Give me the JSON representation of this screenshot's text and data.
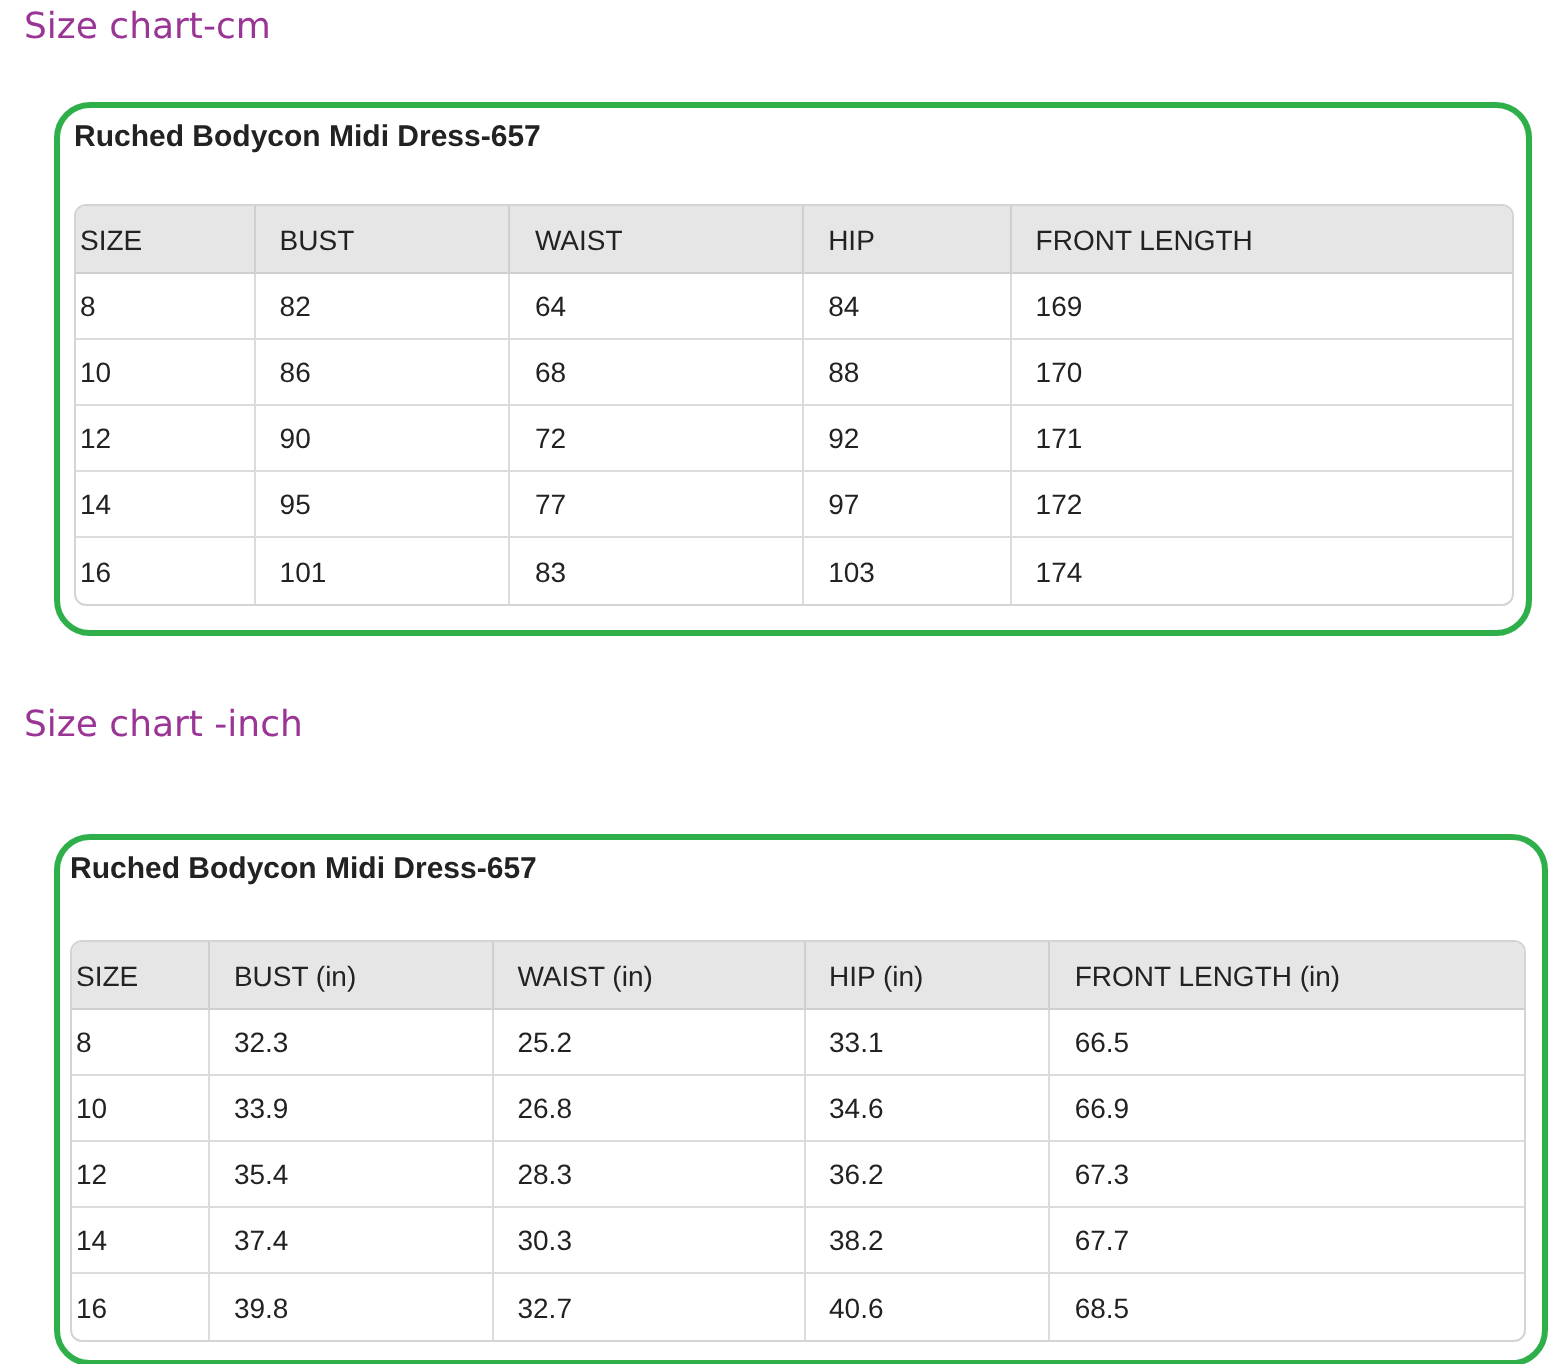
{
  "sections": [
    {
      "heading": "Size chart-cm",
      "table": {
        "title": "Ruched Bodycon Midi Dress-657",
        "columns": [
          "SIZE",
          "BUST",
          "WAIST",
          "HIP",
          "FRONT LENGTH"
        ],
        "rows": [
          [
            "8",
            "82",
            "64",
            "84",
            "169"
          ],
          [
            "10",
            "86",
            "68",
            "88",
            "170"
          ],
          [
            "12",
            "90",
            "72",
            "92",
            "171"
          ],
          [
            "14",
            "95",
            "77",
            "97",
            "172"
          ],
          [
            "16",
            "101",
            "83",
            "103",
            "174"
          ]
        ]
      }
    },
    {
      "heading": "Size chart -inch",
      "table": {
        "title": "Ruched Bodycon Midi Dress-657",
        "columns": [
          "SIZE",
          "BUST (in)",
          "WAIST (in)",
          "HIP (in)",
          "FRONT LENGTH (in)"
        ],
        "rows": [
          [
            "8",
            "32.3",
            "25.2",
            "33.1",
            "66.5"
          ],
          [
            "10",
            "33.9",
            "26.8",
            "34.6",
            "66.9"
          ],
          [
            "12",
            "35.4",
            "28.3",
            "36.2",
            "67.3"
          ],
          [
            "14",
            "37.4",
            "30.3",
            "38.2",
            "67.7"
          ],
          [
            "16",
            "39.8",
            "32.7",
            "40.6",
            "68.5"
          ]
        ]
      }
    }
  ]
}
